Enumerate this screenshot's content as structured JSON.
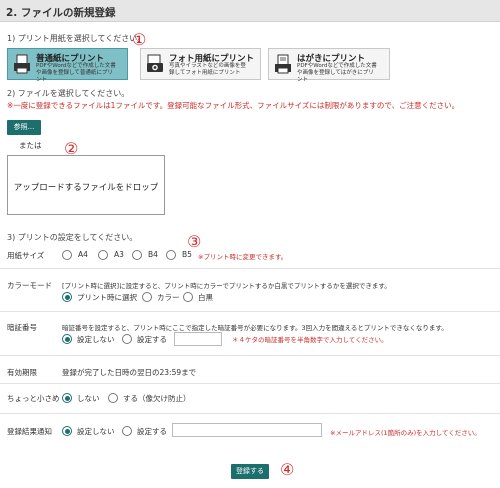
{
  "header": {
    "title": "2. ファイルの新規登録"
  },
  "step1": {
    "label": "1) プリント用紙を選択してください。",
    "types": [
      {
        "name": "普通紙にプリント",
        "desc": "PDFやWordなどで作成した文書や画像を登録して普通紙にプリント",
        "icon": "document-printer-icon",
        "selected": true
      },
      {
        "name": "フォト用紙にプリント",
        "desc": "写真やイラストなどの画像を登録してフォト用紙にプリント",
        "icon": "camera-icon",
        "selected": false
      },
      {
        "name": "はがきにプリント",
        "desc": "PDFやWordなどで作成した文書や画像を登録してはがきにプリント",
        "icon": "postcard-icon",
        "selected": false
      }
    ]
  },
  "step2": {
    "label": "2) ファイルを選択してください。",
    "note": "※一度に登録できるファイルは1ファイルです。登録可能なファイル形式、ファイルサイズには制限がありますので、ご注意ください。",
    "browse_label": "参照...",
    "or_label": "または",
    "drop_label": "アップロードするファイルをドロップ"
  },
  "step3": {
    "label": "3) プリントの設定をしてください。",
    "paper_size": {
      "label": "用紙サイズ",
      "options": [
        "A4",
        "A3",
        "B4",
        "B5"
      ],
      "note": "※プリント時に変更できます。"
    },
    "color_mode": {
      "label": "カラーモード",
      "desc": "[プリント時に選択]に設定すると、プリント時にカラーでプリントするか白黒でプリントするかを選択できます。",
      "options": [
        "プリント時に選択",
        "カラー",
        "白黒"
      ]
    },
    "pin": {
      "label": "暗証番号",
      "desc": "暗証番号を設定すると、プリント時にここで指定した暗証番号が必要になります。3回入力を間違えるとプリントできなくなります。",
      "options": [
        "設定しない",
        "設定する"
      ],
      "note": "＊４ケタの暗証番号を半角数字で入力してください。",
      "input_value": ""
    },
    "expiry": {
      "label": "有効期限",
      "value": "登録が完了した日時の翌日の23:59まで"
    },
    "shrink": {
      "label": "ちょっと小さめ",
      "options": [
        "しない",
        "する（像欠け防止）"
      ]
    },
    "notify": {
      "label": "登録結果通知",
      "options": [
        "設定しない",
        "設定する"
      ],
      "note": "※メールアドレス(1箇所のみ)を入力してください。",
      "input_value": ""
    }
  },
  "submit": {
    "label": "登録する"
  },
  "annotations": [
    "①",
    "②",
    "③",
    "④"
  ],
  "colors": {
    "accent": "#1d6f6e",
    "selected_card": "#7fbfc6",
    "warning": "#cc2b2b",
    "annotation": "#d72b2b"
  }
}
